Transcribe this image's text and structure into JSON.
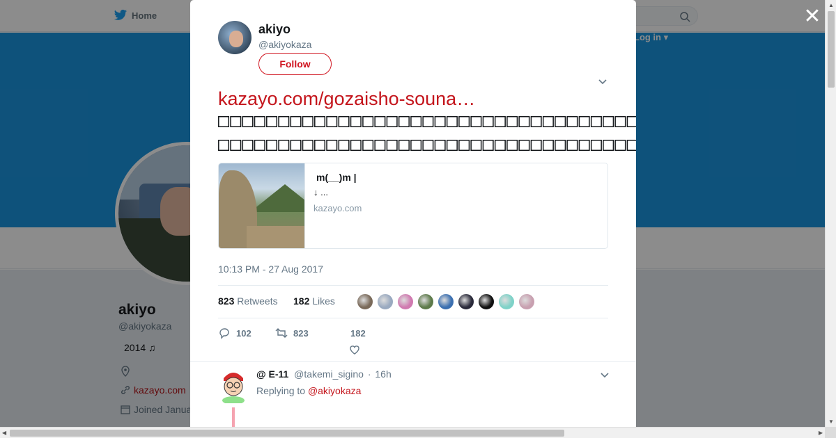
{
  "background": {
    "nav_home_label": "Home",
    "login_label": "Log in",
    "profile_name": "akiyo",
    "profile_handle": "@akiyokaza",
    "bio": "2014 ♫",
    "link_text": "kazayo.com",
    "joined_text": "Joined Janua"
  },
  "modal": {
    "close_symbol": "✕",
    "author_name": "akiyo",
    "author_handle": "@akiyokaza",
    "follow_label": "Follow",
    "tweet_link": "kazayo.com/gozaisho-souna…",
    "tweet_line_1": "□□□□□□□□□□□□□□□□□□□□□□□□□□□□□□□□□□□□□",
    "tweet_line_2": "□□□□□□□□□□□□□□□□□□□□□□□□□□□□□□□□□□□□□□□□□□□□□□□□□□ □□□□□",
    "card": {
      "title": "m(__)m |",
      "description": "↓ ...",
      "domain": "kazayo.com"
    },
    "timestamp": "10:13 PM - 27 Aug 2017",
    "retweets_count": "823",
    "retweets_label": "Retweets",
    "likes_count": "182",
    "likes_label": "Likes",
    "likers_colors": [
      "#7a6a5a",
      "#9aaac0",
      "#d07ab0",
      "#5d7a4a",
      "#3b6fb0",
      "#2a2a3a",
      "#111111",
      "#7fd2c8",
      "#c8a0b0"
    ],
    "reply_count": "102",
    "retweet_action_count": "823",
    "like_action_count": "182"
  },
  "reply": {
    "name": "@ E-11",
    "handle": "@takemi_sigino",
    "separator": "·",
    "time": "16h",
    "replying_prefix": "Replying to",
    "replying_to": "@akiyokaza"
  },
  "colors": {
    "accent": "#c4151c",
    "banner": "#1b95e0",
    "muted": "#657786"
  }
}
